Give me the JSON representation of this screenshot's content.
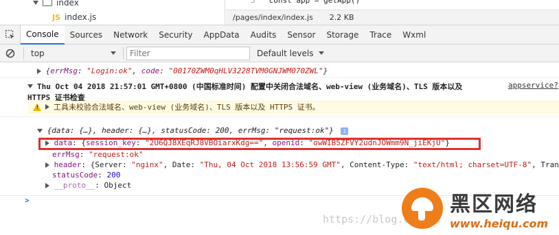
{
  "file_tree": {
    "folder_label": "index",
    "file_badge": "JS",
    "file_label": "index.js"
  },
  "code": {
    "line_number": "3",
    "line_text": "const app = getApp()"
  },
  "file_status": {
    "path": "/pages/index/index.js",
    "size": "2.2 KB"
  },
  "tabs": [
    "Console",
    "Sources",
    "Network",
    "Security",
    "AppData",
    "Audits",
    "Sensor",
    "Storage",
    "Trace",
    "Wxml"
  ],
  "active_tab": "Console",
  "toolbar": {
    "context": "top",
    "filter_placeholder": "Filter",
    "levels": "Default levels"
  },
  "log1": {
    "open": "{",
    "k1": "errMsg",
    "v1": "\"Login:ok\"",
    "k2": "code",
    "v2": "\"00170ZWM0qHLV3228TVM0GNJWM070ZWL\"",
    "close": "}"
  },
  "log2": {
    "text_line1": "Thu Oct 04 2018 21:57:01 GMT+0800 (中国标准时间) 配置中关闭合法域名、web-view (业务域名)、TLS 版本以及",
    "text_line2": "HTTPS 证书检查",
    "source": "appservice?"
  },
  "warning": {
    "text": "工具未校验合法域名、web-view (业务域名)、TLS 版本以及 HTTPS 证书。"
  },
  "log3": {
    "summary": "{data: {…}, header: {…}, statusCode: 200, errMsg: \"request:ok\"}",
    "info_badge": "i",
    "data_key": "data",
    "data_k1": "session_key",
    "data_v1": "\"2U6QJ8XEqRJ8VBOiarxKdg==\"",
    "data_k2": "openid",
    "data_v2": "\"owWIB5ZFVY2udnJOWmm9N_jiEKjU\"",
    "errmsg_key": "errMsg",
    "errmsg_val": "\"request:ok\"",
    "header_key": "header",
    "h_k1": "Server",
    "h_v1": "\"nginx\"",
    "h_k2": "Date",
    "h_v2": "\"Thu, 04 Oct 2018 13:56:59 GMT\"",
    "h_k3": "Content-Type",
    "h_v3": "\"text/html; charset=UTF-8\"",
    "h_k4": "Trans",
    "status_key": "statusCode",
    "status_val": "200",
    "proto_key": "__proto__",
    "proto_val": "Object"
  },
  "prompt_symbol": ">",
  "watermark": {
    "title": "黑区网络",
    "subtitle": "www.heiqu.com",
    "url": "https://blog.csdn.n"
  },
  "colors": {
    "highlight_border": "#e0312f",
    "active_tab_underline": "#1a73e8",
    "warning_bg": "#fffbe5"
  }
}
